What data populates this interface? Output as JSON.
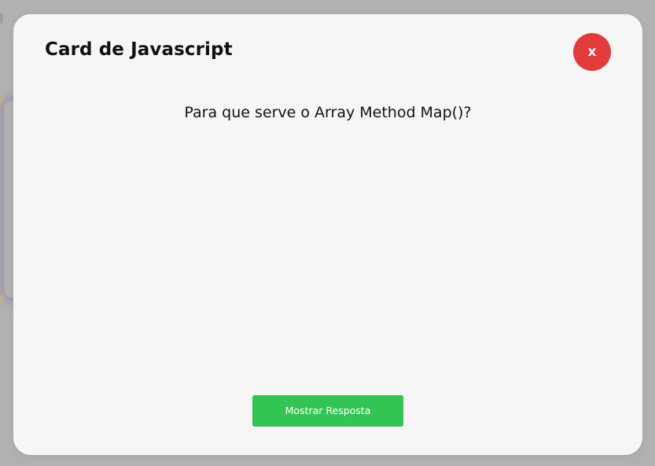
{
  "modal": {
    "title": "Card de Javascript",
    "close_label": "x",
    "question": "Para que serve o Array Method Map()?",
    "answer_button_label": "Mostrar Resposta"
  },
  "colors": {
    "overlay": "#b1b1b1",
    "modal_background": "#f6f6f6",
    "close_button": "#e33a3a",
    "answer_button": "#33c553",
    "background_card_glow_yellow": "#f0d228",
    "background_card_glow_blue": "#786ee6"
  },
  "icons": {
    "close": "x-icon"
  }
}
